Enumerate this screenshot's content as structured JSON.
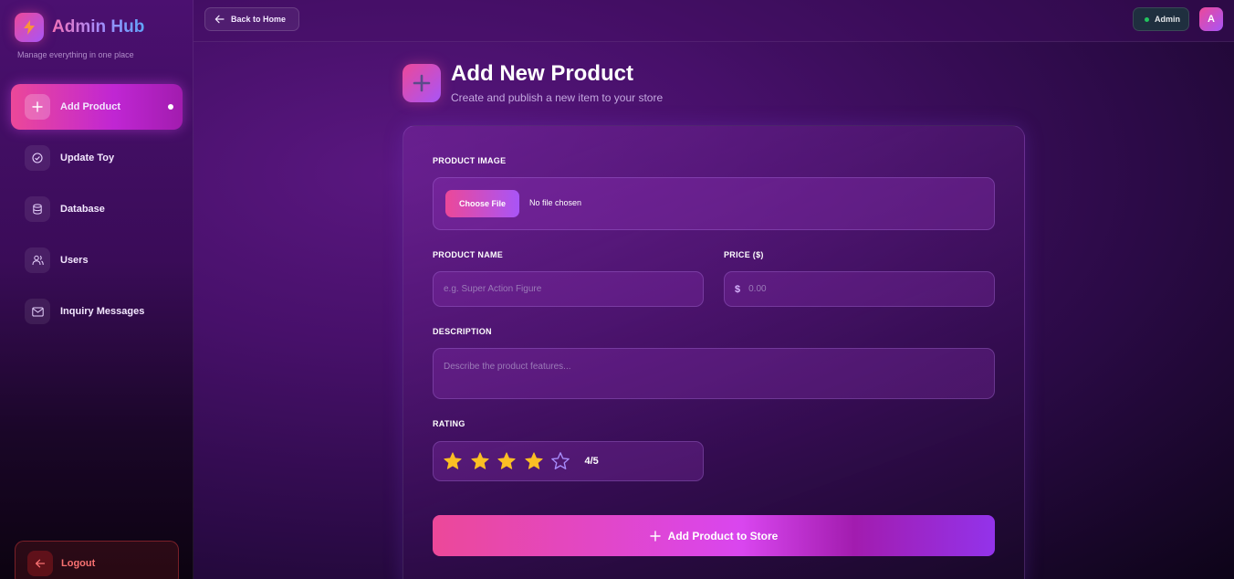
{
  "sidebar": {
    "brand_title": "Admin Hub",
    "brand_subtitle": "Manage everything in one place",
    "items": [
      {
        "label": "Add Product",
        "icon": "plus-icon",
        "active": true
      },
      {
        "label": "Update Toy",
        "icon": "check-circle-icon",
        "active": false
      },
      {
        "label": "Database",
        "icon": "database-icon",
        "active": false
      },
      {
        "label": "Users",
        "icon": "users-icon",
        "active": false
      },
      {
        "label": "Inquiry Messages",
        "icon": "mail-icon",
        "active": false
      }
    ],
    "logout_label": "Logout"
  },
  "topbar": {
    "back_label": "Back to Home",
    "admin_label": "Admin",
    "avatar_initial": "A"
  },
  "page": {
    "title": "Add New Product",
    "subtitle": "Create and publish a new item to your store"
  },
  "form": {
    "image_label": "PRODUCT IMAGE",
    "choose_file_label": "Choose File",
    "no_file_text": "No file chosen",
    "name_label": "PRODUCT NAME",
    "name_placeholder": "e.g. Super Action Figure",
    "price_label": "PRICE ($)",
    "price_symbol": "$",
    "price_placeholder": "0.00",
    "description_label": "DESCRIPTION",
    "description_placeholder": "Describe the product features...",
    "rating_label": "RATING",
    "rating_value": 4,
    "rating_max": 5,
    "rating_text": "4/5",
    "submit_label": "Add Product to Store"
  },
  "colors": {
    "accent_pink": "#ec4899",
    "accent_purple": "#a855f7",
    "star_filled": "#fbbf24",
    "star_empty": "#a78bfa",
    "logout_red": "#f87171",
    "online_green": "#22c55e"
  }
}
